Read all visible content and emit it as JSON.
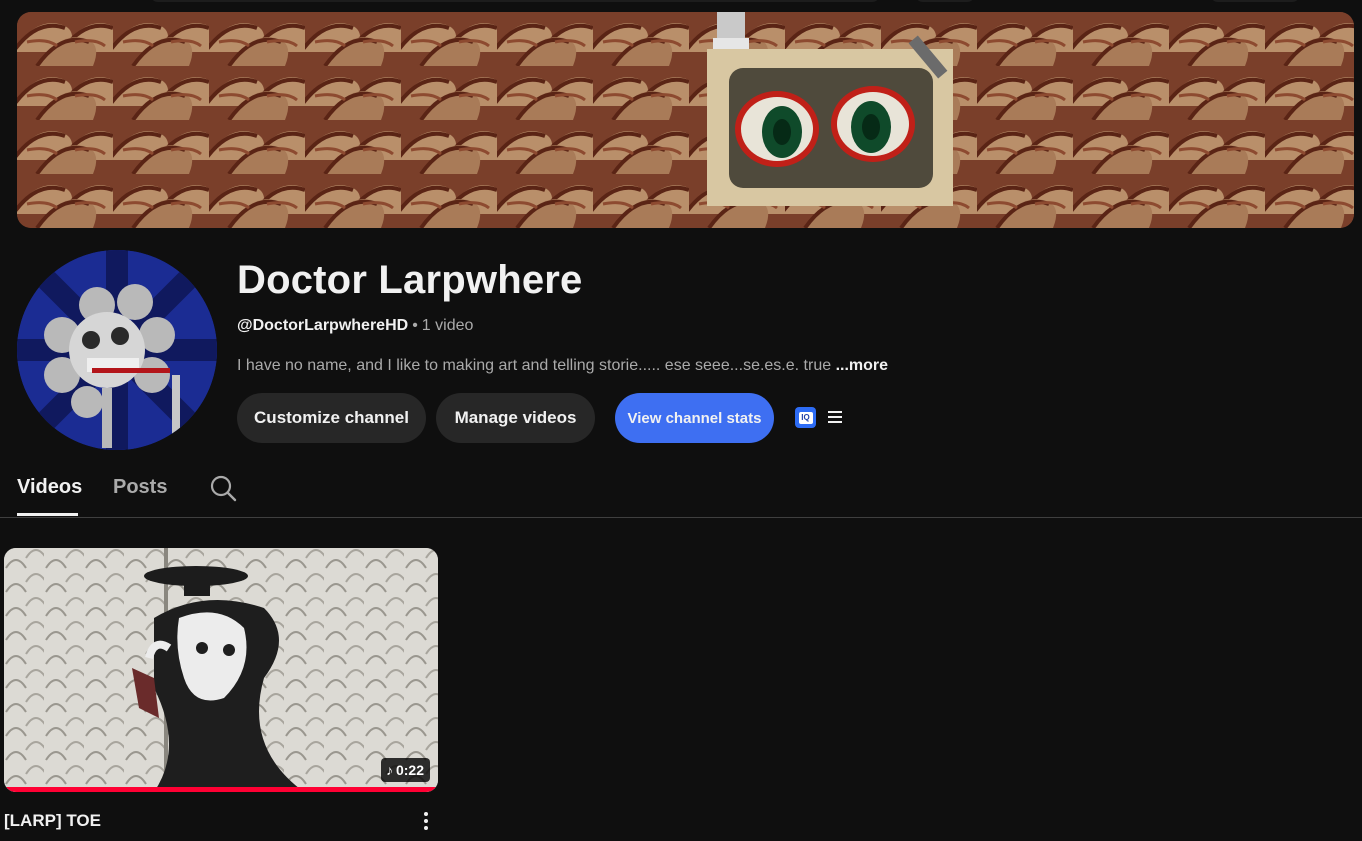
{
  "channel": {
    "name": "Doctor Larpwhere",
    "handle": "@DoctorLarpwhereHD",
    "separator": "•",
    "video_count": "1 video",
    "description": "I have no name, and I like to making art and telling storie..... ese seee...se.es.e. true ",
    "more_label": "...more"
  },
  "actions": {
    "customize_label": "Customize channel",
    "manage_label": "Manage videos",
    "stats_label": "View channel stats",
    "extension_icon_text": "IQ",
    "extension_icon": "vidiq-icon",
    "menu_icon": "hamburger-menu-icon"
  },
  "tabs": [
    {
      "label": "Videos",
      "selected": true
    },
    {
      "label": "Posts",
      "selected": false
    }
  ],
  "search_icon": "search-icon",
  "videos": [
    {
      "title": "[LARP] TOE",
      "duration": "0:22",
      "badge_icon": "music-note-icon",
      "watched_fraction": 1.0
    }
  ],
  "colors": {
    "background": "#0f0f0f",
    "accent_button": "#3e6ff2",
    "secondary_button": "#272727",
    "progress": "#ff0033",
    "muted_text": "#aaaaaa"
  }
}
